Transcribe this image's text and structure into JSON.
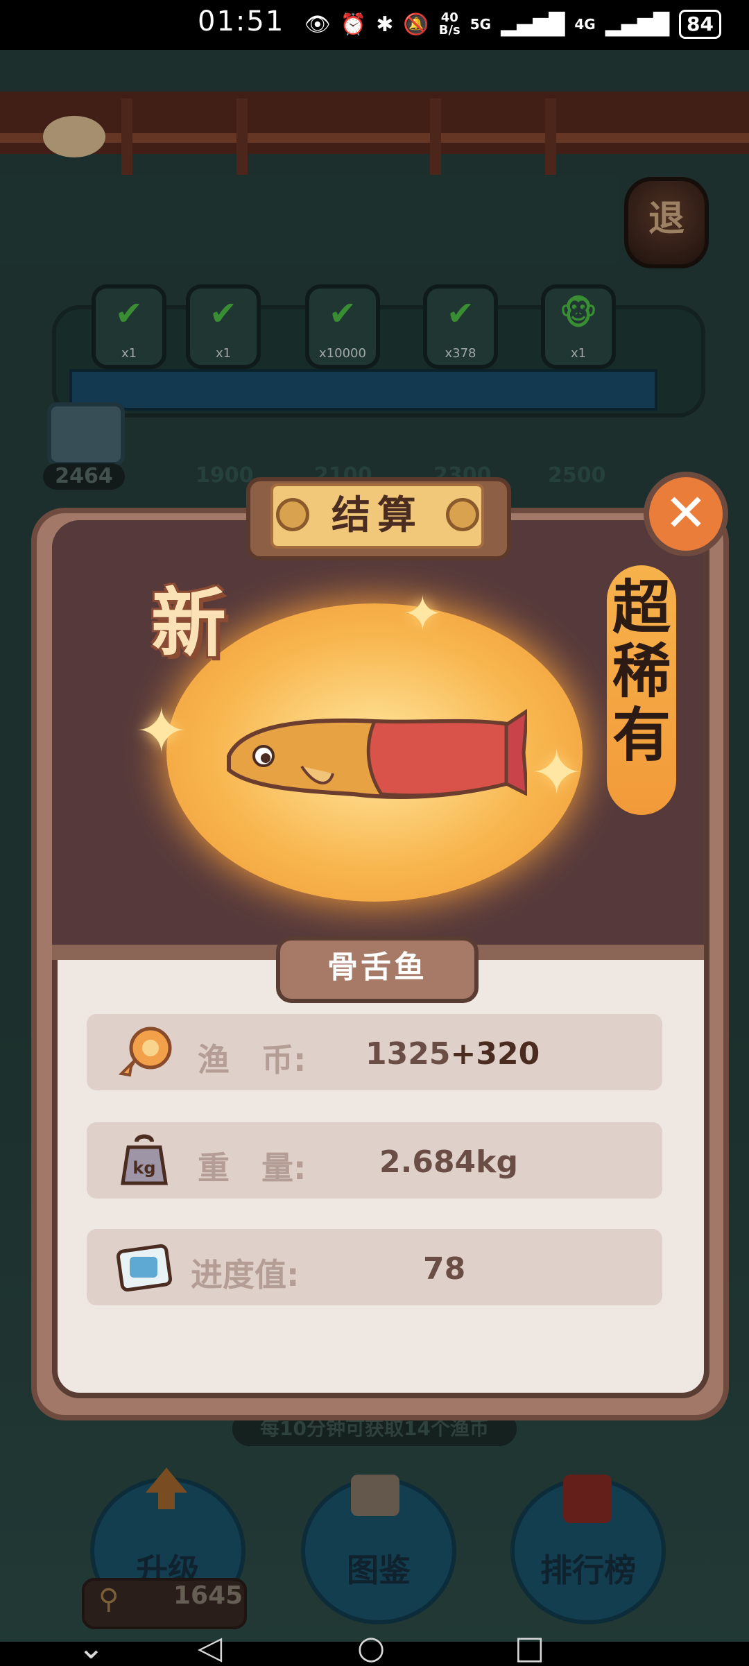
{
  "status_bar": {
    "time": "01:51",
    "net_speed_top": "40",
    "net_speed_bottom": "B/s",
    "sig1": "5G",
    "sig2": "4G",
    "battery": "84",
    "icons": [
      "eye-icon",
      "alarm-icon",
      "bluetooth-icon",
      "mute-icon",
      "signal-icon",
      "signal-icon",
      "battery-icon"
    ]
  },
  "scene": {
    "exit_label": "退",
    "progress_current": "2464",
    "milestones": [
      "1900",
      "2100",
      "2300",
      "2500"
    ],
    "prizes": [
      {
        "count": "x1"
      },
      {
        "count": "x1"
      },
      {
        "count": "x10000"
      },
      {
        "count": "x378"
      },
      {
        "count": "x1"
      }
    ],
    "hint": "每10分钟可获取14个渔币"
  },
  "modal": {
    "title": "结算",
    "new_badge": "新",
    "rarity": "超稀有",
    "fish_name": "骨舌鱼",
    "stats": [
      {
        "icon": "fish-coin-icon",
        "label": "渔　币:",
        "value": "1325",
        "bonus": "+320"
      },
      {
        "icon": "weight-icon",
        "label": "重　量:",
        "value": "2.684kg"
      },
      {
        "icon": "progress-card-icon",
        "label": "进度值:",
        "value": "78"
      }
    ],
    "weight_icon_text": "kg"
  },
  "bottom_nav": {
    "upgrade": "升级",
    "encyclopedia": "图鉴",
    "leaderboard": "排行榜",
    "coins": "1645"
  },
  "colors": {
    "accent_orange": "#ea7d3a",
    "rarity_orange": "#f29a3a",
    "glow": "#f8b64f"
  }
}
